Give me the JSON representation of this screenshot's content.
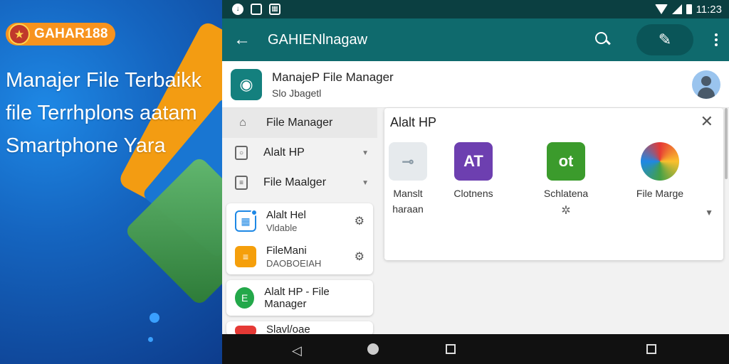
{
  "promo": {
    "brand": "GAHAR188",
    "headline": [
      "Manajer File Terbaikk",
      "file Terrhplons aatam",
      "Smartphone Yara"
    ]
  },
  "statusbar": {
    "time": "11:23"
  },
  "appbar": {
    "title": "GAHIENlnagaw"
  },
  "header": {
    "title": "ManajeP File Manager",
    "subtitle": "Slo Jbagetl"
  },
  "sidebar": {
    "nav": [
      {
        "label": "File Manager",
        "icon": "home-icon"
      },
      {
        "label": "Alalt HP",
        "icon": "phone-icon"
      },
      {
        "label": "File Maalger",
        "icon": "document-icon"
      }
    ],
    "card": [
      {
        "title": "Alalt Hel",
        "sub": "Vldable",
        "color": "#1e88e5"
      },
      {
        "title": "FileMani",
        "sub": "DAOBOEIAH",
        "color": "#f59f0b"
      }
    ],
    "item": {
      "label": "Alalt HP - File Manager",
      "color": "#23a84a"
    },
    "partial": "Slavl/oae"
  },
  "panel": {
    "title": "Alalt HP",
    "apps": [
      {
        "label": "Manslt",
        "sub": "haraan",
        "glyph": "",
        "color": "#e6eaed"
      },
      {
        "label": "Clotnens",
        "sub": "",
        "glyph": "AT",
        "color": "#6d3fb0"
      },
      {
        "label": "Schlatena",
        "sub": "",
        "glyph": "ot",
        "color": "#3b9b2c"
      },
      {
        "label": "File Marge",
        "sub": "",
        "glyph": "",
        "color": "#2b78c8"
      }
    ]
  }
}
